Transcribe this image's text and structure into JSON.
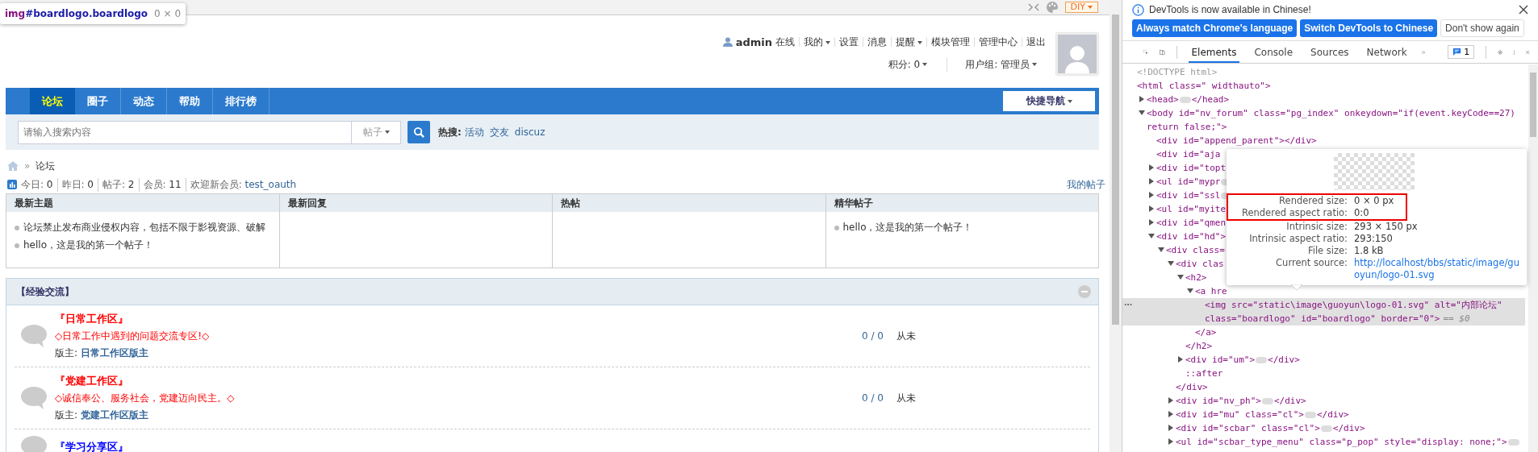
{
  "inspect_tooltip": {
    "tag": "img",
    "selector": "#boardlogo.boardlogo",
    "size": "0 × 0"
  },
  "top_bar": {
    "diy_button": "DIY"
  },
  "user_menu": {
    "username": "admin",
    "status": "在线",
    "links": [
      {
        "label": "我的",
        "dropdown": true
      },
      {
        "label": "设置",
        "dropdown": false
      },
      {
        "label": "消息",
        "dropdown": false
      },
      {
        "label": "提醒",
        "dropdown": true
      },
      {
        "label": "模块管理",
        "dropdown": false
      },
      {
        "label": "管理中心",
        "dropdown": false
      },
      {
        "label": "退出",
        "dropdown": false
      }
    ],
    "info": [
      {
        "label": "积分: 0",
        "dropdown": true
      },
      {
        "label": "用户组: 管理员",
        "dropdown": true
      }
    ]
  },
  "nav": {
    "tabs": [
      {
        "label": "论坛",
        "selected": true
      },
      {
        "label": "圈子",
        "selected": false
      },
      {
        "label": "动态",
        "selected": false
      },
      {
        "label": "帮助",
        "selected": false
      },
      {
        "label": "排行榜",
        "selected": false
      }
    ],
    "quick_nav": "快捷导航"
  },
  "search": {
    "placeholder": "请输入搜索内容",
    "type": "帖子",
    "hot_label": "热搜:",
    "hot_terms": [
      "活动",
      "交友",
      "discuz"
    ]
  },
  "breadcrumb": {
    "separator": "»",
    "current": "论坛"
  },
  "stats": {
    "items": [
      {
        "label": "今日:",
        "value": "0"
      },
      {
        "label": "昨日:",
        "value": "0"
      },
      {
        "label": "帖子:",
        "value": "2"
      },
      {
        "label": "会员:",
        "value": "11"
      },
      {
        "label": "欢迎新会员:",
        "value": "test_oauth"
      }
    ],
    "my_posts": "我的帖子"
  },
  "overview_table": {
    "columns": [
      {
        "title": "最新主题",
        "items": [
          "论坛禁止发布商业侵权内容，包括不限于影视资源、破解",
          "hello，这是我的第一个帖子！"
        ]
      },
      {
        "title": "最新回复"
      },
      {
        "title": "热帖"
      },
      {
        "title": "精华帖子",
        "items": [
          "hello，这是我的第一个帖子！"
        ]
      }
    ]
  },
  "category": {
    "title": "【经验交流】",
    "forums": [
      {
        "name": "『日常工作区』",
        "color": "#ff0000",
        "description": "◇日常工作中遇到的问题交流专区!◇",
        "moderator_label": "版主:",
        "moderator": "日常工作区版主",
        "counts": "0 / 0",
        "last_post": "从未"
      },
      {
        "name": "『党建工作区』",
        "color": "#ff0000",
        "description": "◇诚信奉公、服务社会，党建迈向民主。◇",
        "moderator_label": "版主:",
        "moderator": "党建工作区版主",
        "counts": "0 / 0",
        "last_post": "从未"
      },
      {
        "name": "『学习分享区』",
        "color": "#0000ff"
      }
    ]
  },
  "devtools": {
    "notice": {
      "text": "DevTools is now available in Chinese!",
      "buttons": [
        {
          "label": "Always match Chrome's language",
          "primary": true
        },
        {
          "label": "Switch DevTools to Chinese",
          "primary": true
        },
        {
          "label": "Don't show again",
          "primary": false
        }
      ]
    },
    "tabs": [
      {
        "label": "Elements",
        "selected": true
      },
      {
        "label": "Console",
        "selected": false
      },
      {
        "label": "Sources",
        "selected": false
      },
      {
        "label": "Network",
        "selected": false
      }
    ],
    "issues_count": "1",
    "dom_tree": [
      {
        "text": "<!DOCTYPE html>",
        "selected": false
      },
      {
        "text": "<html class=\" widthauto\">",
        "selected": false,
        "children": [
          {
            "text": "<head>",
            "close": "</head>",
            "expanded": false,
            "selected": false
          },
          {
            "text": "<body id=\"nv_forum\" class=\"pg_index\" onkeydown=\"if(event.keyCode==27) return false;\">",
            "expanded": true,
            "selected": false,
            "children": [
              {
                "text": "<div id=\"append_parent\"></div>",
                "selected": false
              },
              {
                "text": "<div id=\"aja",
                "selected": false
              },
              {
                "text": "<div id=\"topt",
                "expanded": false,
                "selected": false
              },
              {
                "text": "<ul id=\"mypr",
                "expanded": false,
                "selected": false
              },
              {
                "text": "<div id=\"ssl",
                "expanded": false,
                "selected": false
              },
              {
                "text": "<ul id=\"myite",
                "expanded": false,
                "selected": false
              },
              {
                "text": "<div id=\"qmen",
                "expanded": false,
                "selected": false
              },
              {
                "text": "<div id=\"hd\">",
                "expanded": true,
                "selected": false,
                "children": [
                  {
                    "text": "<div class=",
                    "expanded": true,
                    "selected": false,
                    "children": [
                      {
                        "text": "<div clas",
                        "expanded": true,
                        "selected": false,
                        "close": "</div>",
                        "children": [
                          {
                            "text": "<h2>",
                            "expanded": true,
                            "selected": false,
                            "close": "</h2>",
                            "children": [
                              {
                                "text": "<a hre",
                                "expanded": true,
                                "selected": false,
                                "close": "</a>",
                                "children": [
                                  {
                                    "text": "<img src=\"static\\image\\guoyun\\logo-01.svg\" alt=\"内部论坛\" class=\"boardlogo\" id=\"boardlogo\" border=\"0\">",
                                    "suffix": "== $0",
                                    "selected": true
                                  }
                                ]
                              }
                            ]
                          },
                          {
                            "text": "<div id=\"um\">",
                            "close": "</div>",
                            "expanded": false,
                            "selected": false
                          },
                          {
                            "text": "::after",
                            "selected": false
                          }
                        ]
                      },
                      {
                        "text": "<div id=\"nv_ph\">",
                        "close": "</div>",
                        "expanded": false,
                        "selected": false
                      },
                      {
                        "text": "<div id=\"mu\" class=\"cl\">",
                        "close": "</div>",
                        "expanded": false,
                        "selected": false
                      },
                      {
                        "text": "<div id=\"scbar\" class=\"cl\">",
                        "close": "</div>",
                        "expanded": false,
                        "selected": false
                      },
                      {
                        "text": "<ul id=\"scbar_type_menu\" class=\"p_pop\" style=\"display: none;\">",
                        "expanded": false,
                        "selected": false
                      }
                    ]
                  }
                ]
              }
            ]
          }
        ]
      }
    ],
    "image_popup": {
      "rows": [
        {
          "label": "Rendered size:",
          "value": "0 × 0 px",
          "highlighted": true
        },
        {
          "label": "Rendered aspect ratio:",
          "value": "0:0",
          "highlighted": true
        },
        {
          "label": "Intrinsic size:",
          "value": "293 × 150 px",
          "highlighted": false
        },
        {
          "label": "Intrinsic aspect ratio:",
          "value": "293:150",
          "highlighted": false
        },
        {
          "label": "File size:",
          "value": "1.8 kB",
          "highlighted": false
        }
      ],
      "source_label": "Current source:",
      "source_url": "http://localhost/bbs/static/image/guoyun/logo-01.svg"
    }
  }
}
